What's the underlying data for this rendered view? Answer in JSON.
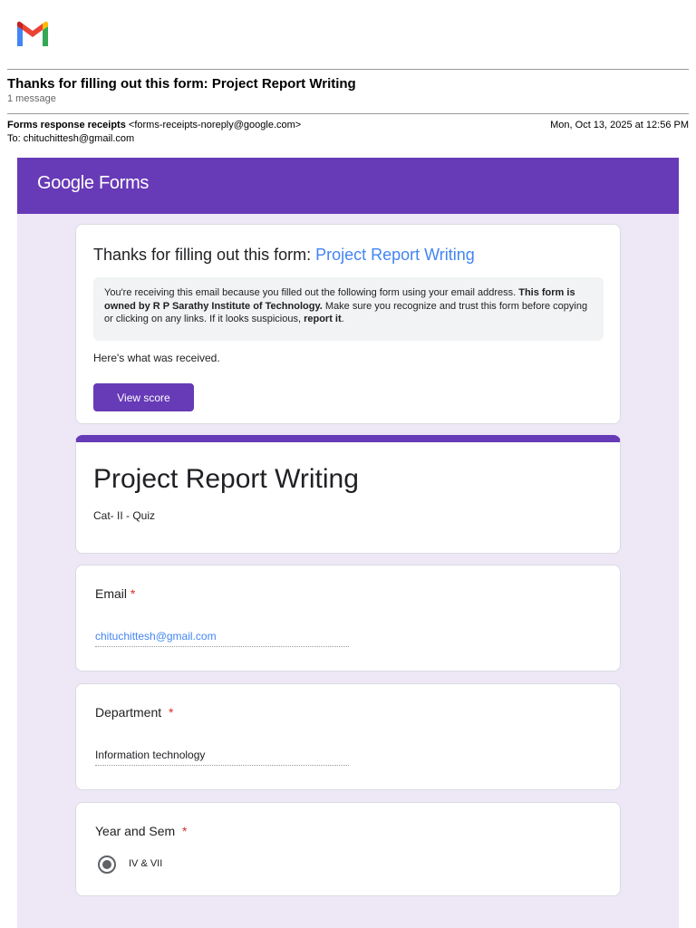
{
  "email": {
    "subject": "Thanks for filling out this form: Project Report Writing",
    "message_count": "1 message",
    "from_name": "Forms response receipts",
    "from_address": "<forms-receipts-noreply@google.com>",
    "to": "To: chituchittesh@gmail.com",
    "date": "Mon, Oct 13, 2025 at 12:56 PM"
  },
  "forms_header": {
    "logo_google": "Google",
    "logo_forms": "Forms",
    "color": "#673ab7"
  },
  "thanks_card": {
    "title_prefix": "Thanks for filling out this form: ",
    "title_link": "Project Report Writing",
    "notice_part1": "You're receiving this email because you filled out the following form using your email address. ",
    "notice_bold": "This form is owned by R P Sarathy Institute of Technology.",
    "notice_part2": " Make sure you recognize and trust this form before copying or clicking on any links. If it looks suspicious, ",
    "notice_report": "report it",
    "notice_end": ".",
    "received": "Here's what was received.",
    "view_score": "View score"
  },
  "form": {
    "title": "Project Report Writing",
    "description": "Cat- II - Quiz"
  },
  "questions": {
    "email": {
      "label": "Email",
      "required": "*",
      "answer": "chituchittesh@gmail.com"
    },
    "department": {
      "label": "Department",
      "required": "*",
      "answer": "Information technology"
    },
    "year": {
      "label": "Year and Sem",
      "required": "*",
      "answer": "IV & VII"
    }
  }
}
